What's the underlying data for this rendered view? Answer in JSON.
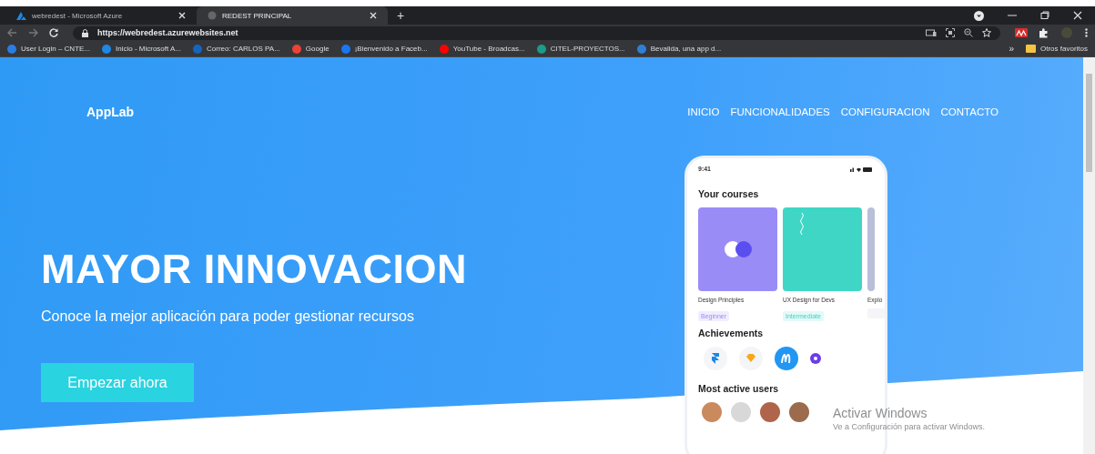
{
  "browser": {
    "tabs": [
      {
        "title": "webredest - Microsoft Azure",
        "selected": false
      },
      {
        "title": "REDEST PRINCIPAL",
        "selected": true
      }
    ],
    "new_tab": "+",
    "address": "https://webredest.azurewebsites.net",
    "bookmarks": [
      "User Login – CNTE...",
      "Inicio - Microsoft A...",
      "Correo: CARLOS PA...",
      "Google",
      "¡Bienvenido a Faceb...",
      "YouTube - Broadcas...",
      "CITEL-PROYECTOS...",
      "Bevalida, una app d..."
    ],
    "bookmarks_overflow": "»",
    "other_bookmarks": "Otros favoritos"
  },
  "page": {
    "brand": "AppLab",
    "nav": [
      "INICIO",
      "FUNCIONALIDADES",
      "CONFIGURACION",
      "CONTACTO"
    ],
    "headline": "MAYOR INNOVACION",
    "subtitle": "Conoce la mejor aplicación para poder gestionar recursos",
    "cta": "Empezar ahora",
    "phone": {
      "time": "9:41",
      "courses_title": "Your courses",
      "courses": [
        {
          "title": "Design Principles",
          "tag": "Beginner",
          "color": "#9a8cf7"
        },
        {
          "title": "UX Design for Devs",
          "tag": "Intermediate",
          "color": "#3fd6c6"
        },
        {
          "title": "Explo",
          "color": "#b9bfd8"
        }
      ],
      "achievements_title": "Achievements",
      "users_title": "Most active users"
    }
  },
  "activation": {
    "title": "Activar Windows",
    "subtitle": "Ve a Configuración para activar Windows."
  }
}
